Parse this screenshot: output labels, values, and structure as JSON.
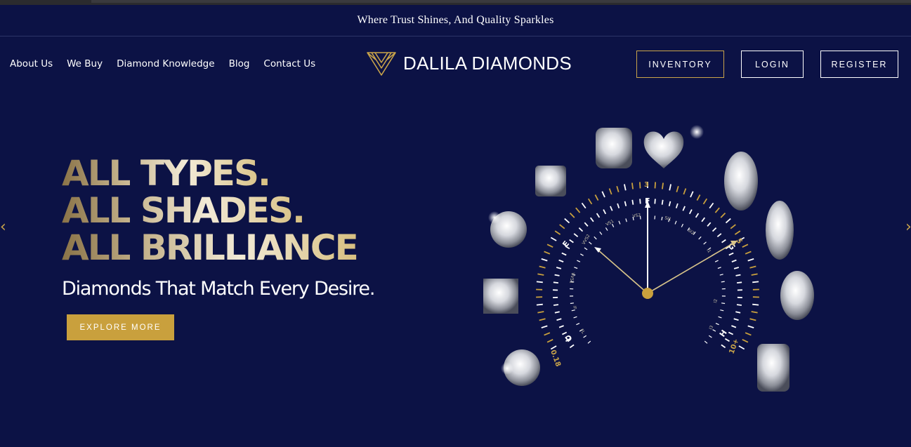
{
  "topbar": {
    "tagline": "Where Trust Shines, And Quality Sparkles"
  },
  "nav": {
    "items": [
      {
        "label": "About Us"
      },
      {
        "label": "We Buy"
      },
      {
        "label": "Diamond Knowledge"
      },
      {
        "label": "Blog"
      },
      {
        "label": "Contact Us"
      }
    ]
  },
  "logo": {
    "text": "DALILA DIAMONDS",
    "icon": "diamond-logo-icon"
  },
  "buttons": {
    "inventory": "INVENTORY",
    "login": "LOGIN",
    "register": "REGISTER"
  },
  "hero": {
    "line1": "ALL TYPES.",
    "line2": "ALL SHADES.",
    "line3": "ALL BRILLIANCE",
    "subheading": "Diamonds That Match Every Desire.",
    "cta": "EXPLORE MORE"
  },
  "dial": {
    "color_grades": [
      "D",
      "E",
      "F",
      "G",
      "H"
    ],
    "carat_labels": [
      "0.18",
      "3",
      "5",
      "10+"
    ],
    "clarity_labels": [
      "FL",
      "IF",
      "VVS1",
      "VVS2",
      "VS1",
      "VS2",
      "SI1",
      "SI2",
      "I1",
      "I2",
      "I3"
    ]
  },
  "colors": {
    "background": "#0c1245",
    "gold": "#c9a03d",
    "white": "#ffffff"
  }
}
